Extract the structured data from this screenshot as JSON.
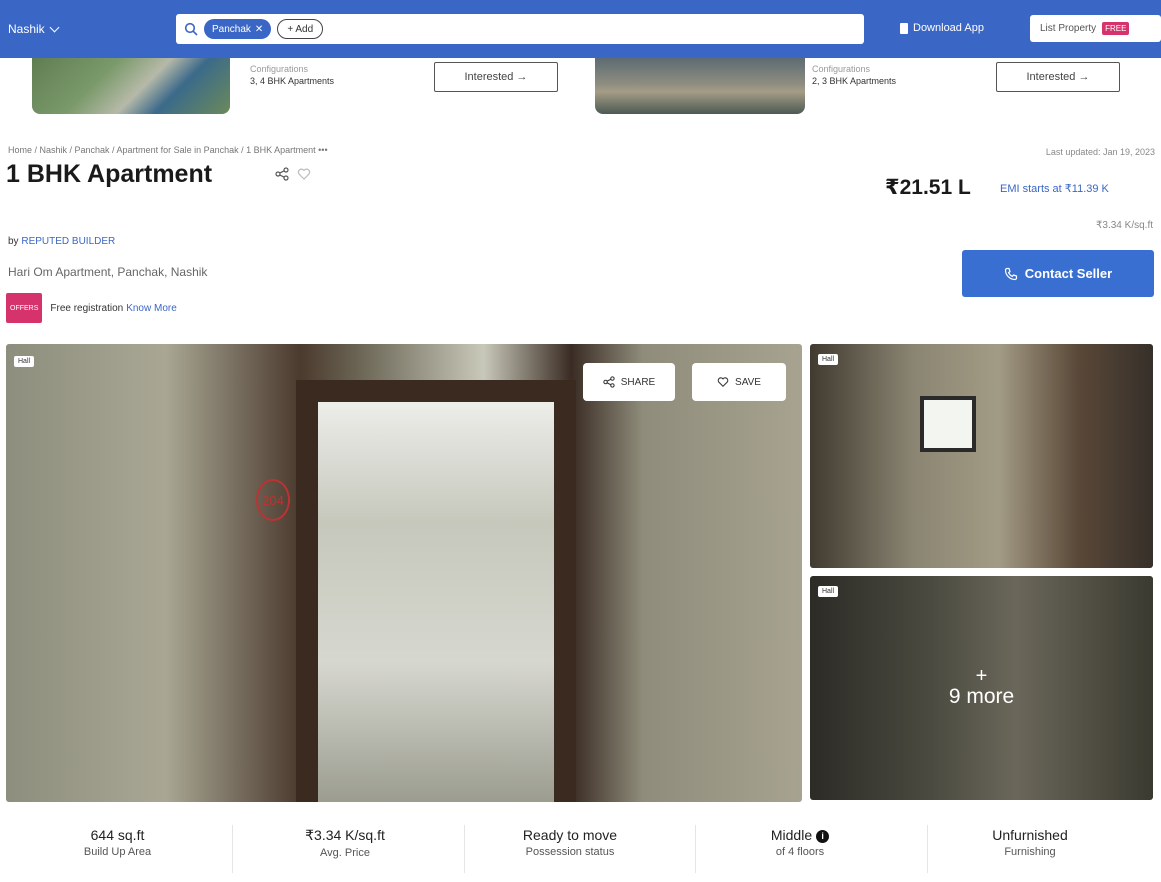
{
  "nav": {
    "city": "Nashik",
    "search_chip": "Panchak",
    "add_label": "+ Add",
    "download_app": "Download App",
    "list_property": "List Property",
    "free_badge": "FREE"
  },
  "similar": [
    {
      "config_label": "Configurations",
      "config_value": "3, 4 BHK Apartments",
      "cta": "Interested →"
    },
    {
      "config_label": "Configurations",
      "config_value": "2, 3 BHK Apartments",
      "cta": "Interested →"
    }
  ],
  "breadcrumb": "Home / Nashik / Panchak / Apartment for Sale in Panchak / 1 BHK Apartment   •••",
  "last_updated": "Last updated: Jan 19, 2023",
  "listing": {
    "title": "1 BHK Apartment",
    "builder_prefix": "by ",
    "builder": "REPUTED BUILDER",
    "address": "Hari Om Apartment, Panchak, Nashik",
    "offers_badge": "OFFERS",
    "offer_text": "Free registration",
    "know_more": "Know More",
    "price": "₹21.51 L",
    "emi": "EMI starts at ₹11.39 K",
    "per_sqft": "₹3.34 K/sq.ft",
    "contact_cta": "Contact Seller"
  },
  "gallery": {
    "main_tag": "Hall",
    "room_number": "204",
    "share_label": "SHARE",
    "save_label": "SAVE",
    "side1_tag": "Hall",
    "side2_tag": "Hall",
    "more_plus": "+",
    "more_text": "9 more"
  },
  "stats": [
    {
      "value": "644 sq.ft",
      "label": "Build Up Area"
    },
    {
      "value": "₹3.34 K/sq.ft",
      "label": "Avg. Price"
    },
    {
      "value": "Ready to move",
      "label": "Possession status"
    },
    {
      "value": "Middle",
      "label": "of 4 floors"
    },
    {
      "value": "Unfurnished",
      "label": "Furnishing"
    }
  ],
  "colors": {
    "primary": "#3a66c6",
    "accent": "#d6336c"
  }
}
